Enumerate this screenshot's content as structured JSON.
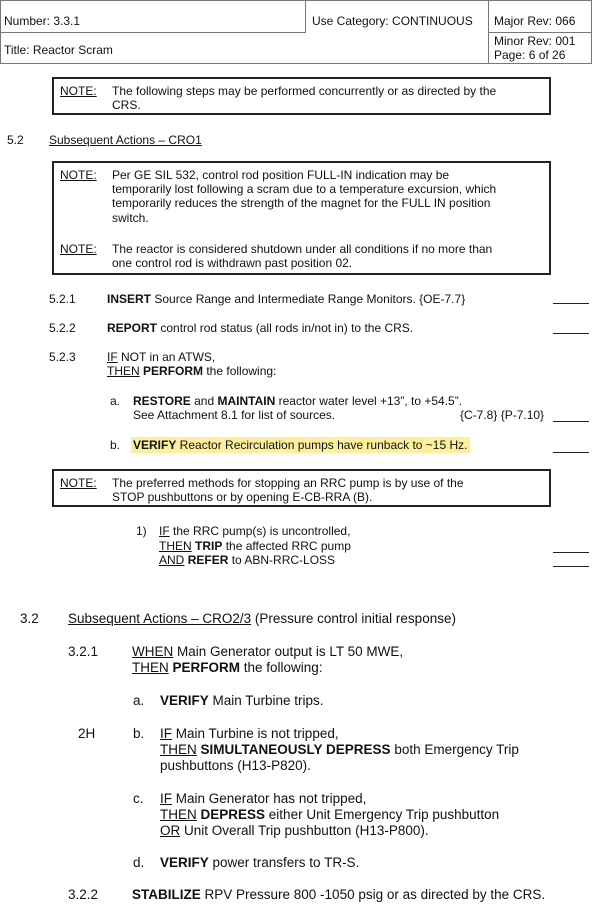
{
  "header": {
    "number": "Number: 3.3.1",
    "use_category": "Use Category: CONTINUOUS",
    "major_rev": "Major Rev:  066",
    "title": "Title: Reactor Scram",
    "minor_rev": "Minor Rev:  001",
    "page": "Page: 6 of 26"
  },
  "note_top": {
    "label": "NOTE:",
    "line1": "The following steps may be performed concurrently or as directed by the",
    "line2": "CRS."
  },
  "section_5_2": {
    "number": "5.2",
    "title": "Subsequent Actions – CRO1"
  },
  "note_box_2": {
    "label1": "NOTE:",
    "n1_l1": "Per GE SIL 532, control rod position FULL-IN indication may be",
    "n1_l2": "temporarily lost following a scram due to a temperature excursion, which",
    "n1_l3": "temporarily reduces the  strength of the magnet for the FULL IN position",
    "n1_l4": "switch.",
    "label2": "NOTE:",
    "n2_l1": "The reactor is considered shutdown under all conditions if no more than",
    "n2_l2": "one control rod is withdrawn past position 02."
  },
  "steps": {
    "s521_num": "5.2.1",
    "s521_verb": "INSERT",
    "s521_text": " Source Range and Intermediate Range Monitors. {OE-7.7}",
    "s522_num": "5.2.2",
    "s522_verb": "REPORT",
    "s522_text": " control rod status (all rods in/not in) to the CRS.",
    "s523_num": "5.2.3",
    "s523_if": "IF",
    "s523_if_text": " NOT in an ATWS,",
    "s523_then": "THEN",
    "s523_perform": "PERFORM",
    "s523_tail": " the following:",
    "a_letter": "a.",
    "a_restore": "RESTORE",
    "a_and": " and ",
    "a_maintain": "MAINTAIN",
    "a_text": " reactor water level +13”, to +54.5”.",
    "a_line2": "See Attachment 8.1 for list of sources.",
    "a_refs": "{C-7.8} {P-7.10}",
    "b_letter": "b.",
    "b_verify": "VERIFY",
    "b_text": " Reactor Recirculation pumps have runback to ~15 Hz."
  },
  "note_3": {
    "label": "NOTE:",
    "line1": "The preferred methods for stopping an RRC pump is by use of the",
    "line2": "STOP pushbuttons or by opening E-CB-RRA (B)."
  },
  "substep_1": {
    "num": "1)",
    "if": "IF",
    "l1": " the RRC pump(s) is uncontrolled,",
    "then": "THEN",
    "trip": "TRIP",
    "l2": " the affected RRC pump",
    "and": "AND",
    "refer": "REFER",
    "l3": " to ABN-RRC-LOSS"
  },
  "section_3_2": {
    "number": "3.2",
    "title": "Subsequent Actions – CRO2/3",
    "title_tail": " (Pressure control initial response)"
  },
  "step_321": {
    "num": "3.2.1",
    "when": "WHEN",
    "l1": " Main Generator output is LT 50 MWE,",
    "then": "THEN",
    "perform": "PERFORM",
    "l2": " the following:",
    "a_letter": "a.",
    "a_verify": "VERIFY",
    "a_text": " Main Turbine trips.",
    "b_tag": "2H",
    "b_letter": "b.",
    "b_if": "IF",
    "b_l1": " Main Turbine is not tripped,",
    "b_then": "THEN",
    "b_sim": "SIMULTANEOUSLY DEPRESS",
    "b_l2": " both Emergency Trip",
    "b_l3": "pushbuttons (H13-P820).",
    "c_letter": "c.",
    "c_if": "IF",
    "c_l1": " Main Generator has not tripped,",
    "c_then": "THEN",
    "c_depress": "DEPRESS",
    "c_l2": " either Unit Emergency Trip pushbutton",
    "c_or": "OR",
    "c_l3": " Unit Overall Trip pushbutton (H13-P800).",
    "d_letter": "d.",
    "d_verify": "VERIFY",
    "d_text": " power transfers to TR-S."
  },
  "step_322": {
    "num": "3.2.2",
    "stabilize": "STABILIZE",
    "text": " RPV Pressure 800 -1050 psig or as directed by the CRS."
  }
}
